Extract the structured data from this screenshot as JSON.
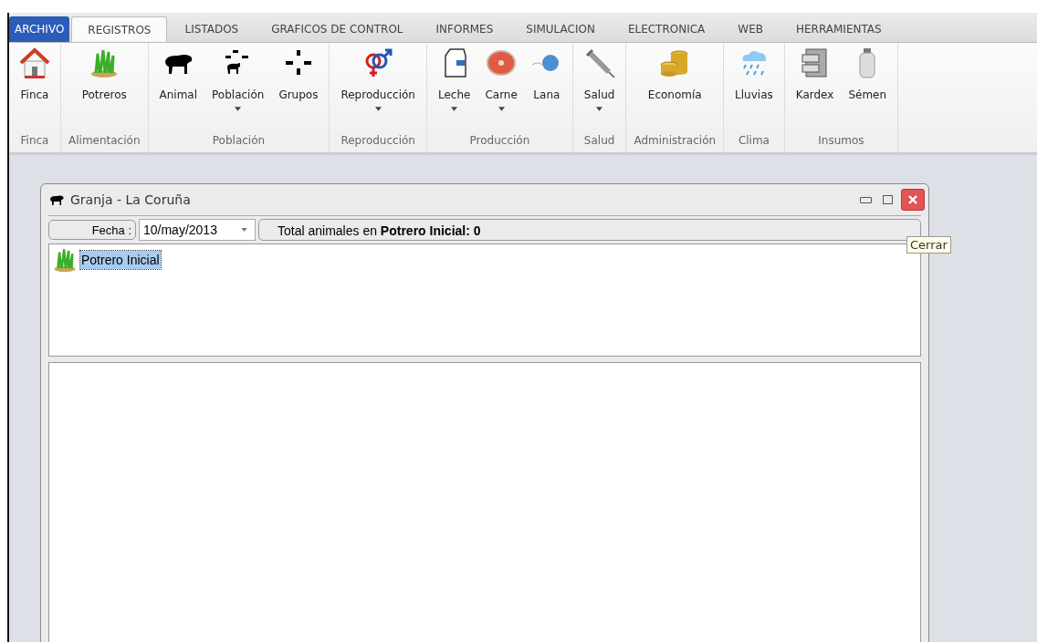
{
  "tabs": [
    {
      "label": "ARCHIVO",
      "kind": "file",
      "selected": false
    },
    {
      "label": "REGISTROS",
      "kind": "tab",
      "selected": true
    },
    {
      "label": "LISTADOS",
      "kind": "tab",
      "selected": false
    },
    {
      "label": "GRAFICOS DE CONTROL",
      "kind": "tab",
      "selected": false
    },
    {
      "label": "INFORMES",
      "kind": "tab",
      "selected": false
    },
    {
      "label": "SIMULACION",
      "kind": "tab",
      "selected": false
    },
    {
      "label": "ELECTRONICA",
      "kind": "tab",
      "selected": false
    },
    {
      "label": "WEB",
      "kind": "tab",
      "selected": false
    },
    {
      "label": "HERRAMIENTAS",
      "kind": "tab",
      "selected": false
    }
  ],
  "ribbon": {
    "groups": [
      {
        "label": "Finca",
        "buttons": [
          {
            "label": "Finca",
            "dropdown": false
          }
        ]
      },
      {
        "label": "Alimentación",
        "buttons": [
          {
            "label": "Potreros",
            "dropdown": false
          }
        ]
      },
      {
        "label": "Población",
        "buttons": [
          {
            "label": "Animal",
            "dropdown": false
          },
          {
            "label": "Población",
            "dropdown": true
          },
          {
            "label": "Grupos",
            "dropdown": false
          }
        ]
      },
      {
        "label": "Reproducción",
        "buttons": [
          {
            "label": "Reproducción",
            "dropdown": true
          }
        ]
      },
      {
        "label": "Producción",
        "buttons": [
          {
            "label": "Leche",
            "dropdown": true
          },
          {
            "label": "Carne",
            "dropdown": true
          },
          {
            "label": "Lana",
            "dropdown": false
          }
        ]
      },
      {
        "label": "Salud",
        "buttons": [
          {
            "label": "Salud",
            "dropdown": true
          }
        ]
      },
      {
        "label": "Administración",
        "buttons": [
          {
            "label": "Economía",
            "dropdown": false
          }
        ]
      },
      {
        "label": "Clima",
        "buttons": [
          {
            "label": "Lluvias",
            "dropdown": false
          }
        ]
      },
      {
        "label": "Insumos",
        "buttons": [
          {
            "label": "Kardex",
            "dropdown": false
          },
          {
            "label": "Sémen",
            "dropdown": false
          }
        ]
      }
    ]
  },
  "child_window": {
    "title": "Granja - La Coruña",
    "toolbar": {
      "date_label": "Fecha :",
      "date_value": "10/may/2013",
      "summary": "Total animales en **Potrero Inicial: 0**"
    },
    "tree": [
      {
        "label": "Potrero Inicial",
        "selected": true
      }
    ],
    "tooltip": "Cerrar"
  }
}
